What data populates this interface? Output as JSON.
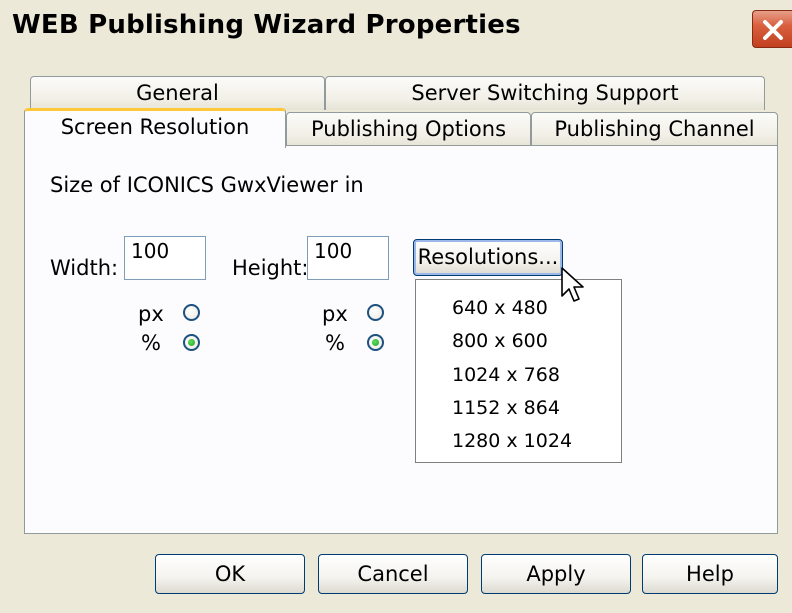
{
  "window": {
    "title": "WEB Publishing Wizard Properties"
  },
  "tabs": {
    "row1": [
      {
        "label": "General"
      },
      {
        "label": "Server Switching Support"
      }
    ],
    "row2": [
      {
        "label": "Screen Resolution",
        "active": true
      },
      {
        "label": "Publishing Options"
      },
      {
        "label": "Publishing Channel"
      }
    ]
  },
  "panel": {
    "size_label": "Size of ICONICS GwxViewer in",
    "width_label": "Width:",
    "width_value": "100",
    "height_label": "Height:",
    "height_value": "100",
    "unit_px": "px",
    "unit_pct": "%",
    "width_unit_selected": "%",
    "height_unit_selected": "%",
    "resolutions_button": "Resolutions...",
    "resolutions_menu": [
      "640 x 480",
      "800 x 600",
      "1024 x 768",
      "1152 x 864",
      "1280 x 1024"
    ]
  },
  "buttons": {
    "ok": "OK",
    "cancel": "Cancel",
    "apply": "Apply",
    "help": "Help"
  },
  "colors": {
    "dialog_bg": "#ECE9D8",
    "active_tab_accent": "#FFC83C",
    "radio_selected": "#21A121",
    "close_button": "#D9603F"
  },
  "icons": {
    "close": "close-icon",
    "cursor": "mouse-pointer-icon"
  }
}
